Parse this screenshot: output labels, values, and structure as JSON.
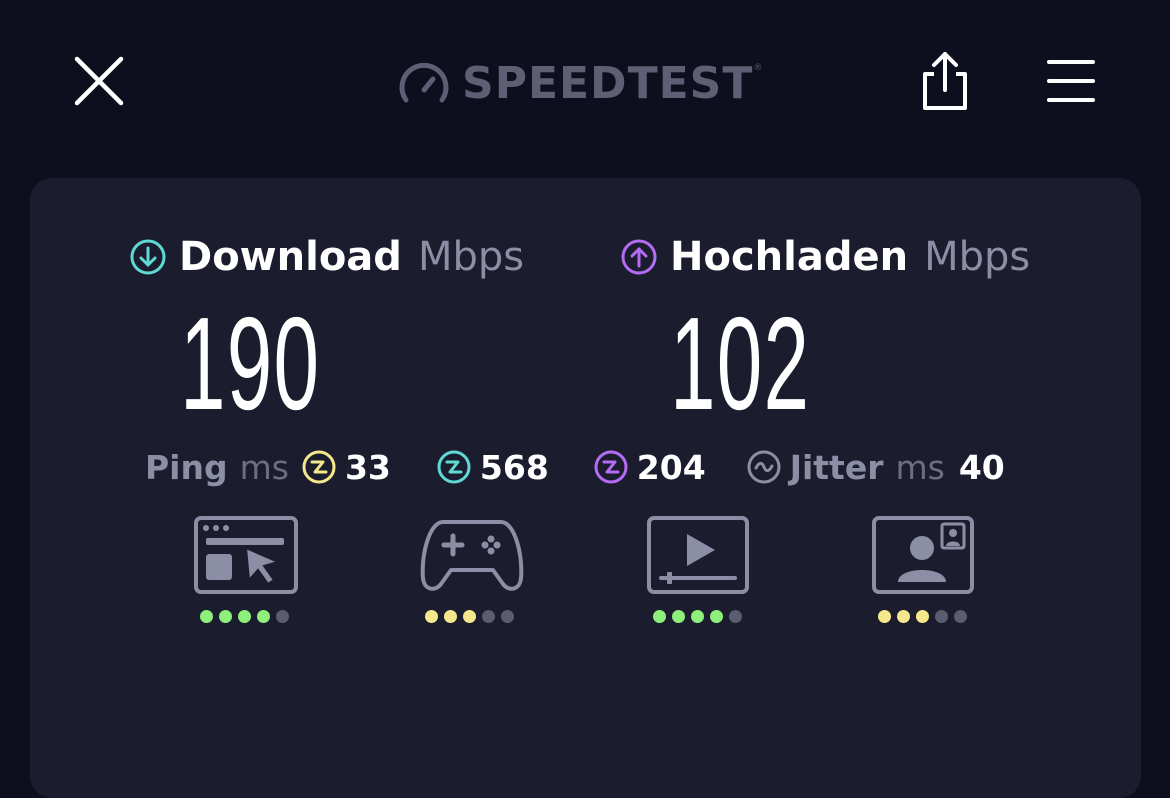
{
  "header": {
    "logo_text": "SPEEDTEST",
    "logo_tm": "®"
  },
  "download": {
    "label": "Download",
    "unit": "Mbps",
    "value": "190",
    "accent": "#5fd9d3"
  },
  "upload": {
    "label": "Hochladen",
    "unit": "Mbps",
    "value": "102",
    "accent": "#b46cf5"
  },
  "ping": {
    "label": "Ping",
    "unit": "ms",
    "idle": "33",
    "download": "568",
    "upload": "204"
  },
  "jitter": {
    "label": "Jitter",
    "unit": "ms",
    "value": "40"
  },
  "apps": [
    {
      "name": "browsing",
      "icon": "browser-icon",
      "rating": 4,
      "max": 5,
      "color": "#8ef07a"
    },
    {
      "name": "gaming",
      "icon": "gamepad-icon",
      "rating": 3,
      "max": 5,
      "color": "#f5e88c"
    },
    {
      "name": "video",
      "icon": "video-player-icon",
      "rating": 4,
      "max": 5,
      "color": "#8ef07a"
    },
    {
      "name": "video-calls",
      "icon": "video-call-icon",
      "rating": 3,
      "max": 5,
      "color": "#f5e88c"
    }
  ],
  "colors": {
    "background": "#0e0f1e",
    "card": "#1b1d2f",
    "idle_ping": "#f5e88c",
    "download_ping": "#5fd9d3",
    "upload_ping": "#b46cf5",
    "inactive_dot": "#5a5c70"
  }
}
